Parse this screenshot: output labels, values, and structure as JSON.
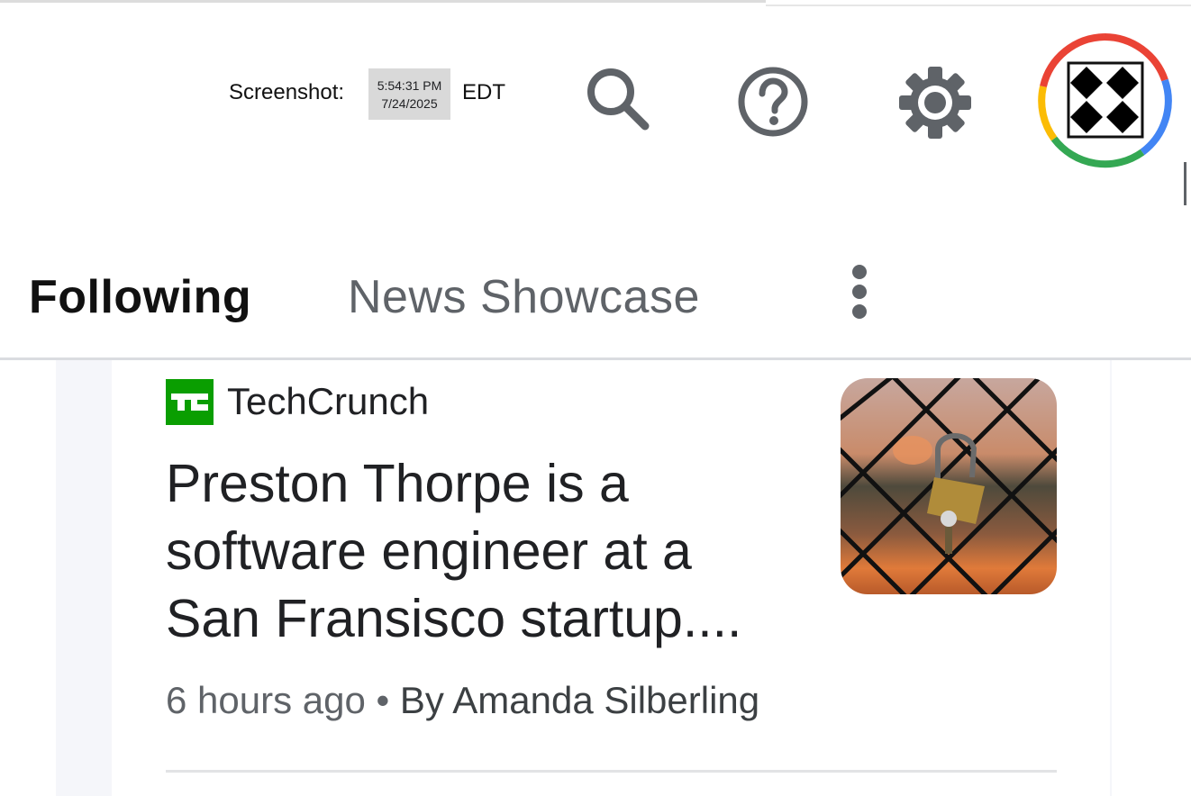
{
  "screenshot_stamp": {
    "label": "Screenshot:",
    "time": "5:54:31 PM",
    "date": "7/24/2025",
    "timezone": "EDT"
  },
  "header": {
    "icons": [
      "search-icon",
      "help-icon",
      "settings-icon",
      "account-avatar"
    ]
  },
  "tabs": [
    {
      "label": "Following",
      "selected": true
    },
    {
      "label": "News Showcase",
      "selected": false
    }
  ],
  "article": {
    "source": "TechCrunch",
    "source_logo_text": "TC",
    "headline": "Preston Thorpe is a software engineer at a San Fransisco startup....",
    "time_ago": "6 hours ago",
    "separator": "•",
    "author": "By Amanda Silberling",
    "thumbnail": "padlock-on-fence-image"
  },
  "colors": {
    "tc_green": "#0a9e01",
    "icon_gray": "#5f6368",
    "google_red": "#ea4335",
    "google_blue": "#4285f4",
    "google_green": "#34a853",
    "google_yellow": "#fbbc05"
  }
}
